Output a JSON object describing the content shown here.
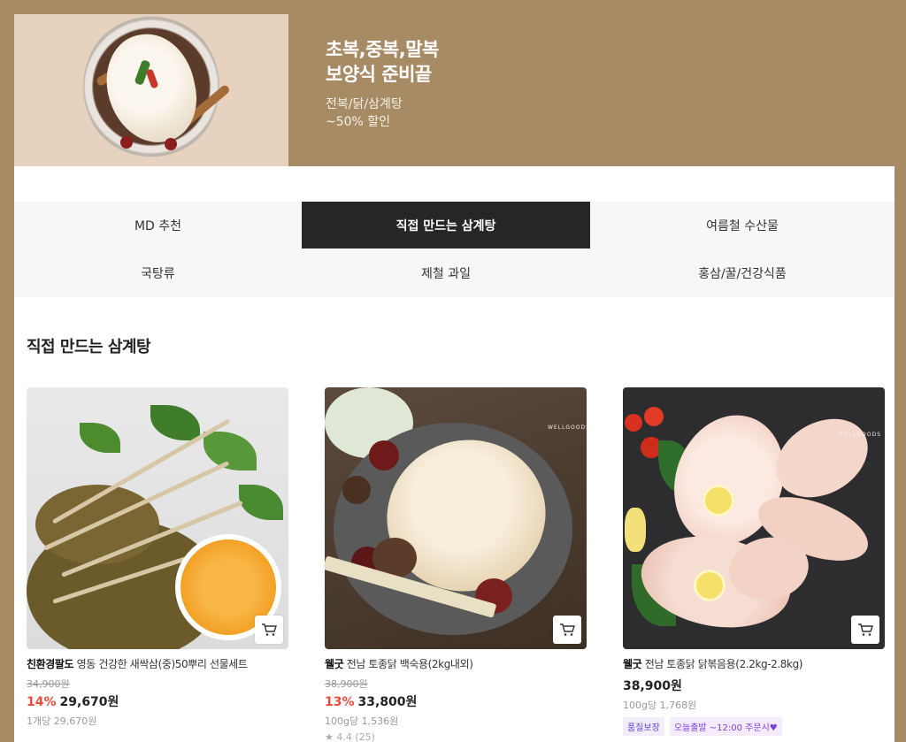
{
  "banner": {
    "title": "초복,중복,말복\n보양식 준비끝",
    "subtitle": "전복/닭/삼계탕\n~50% 할인"
  },
  "tabs": [
    {
      "label": "MD 추천",
      "active": false
    },
    {
      "label": "직접 만드는 삼계탕",
      "active": true
    },
    {
      "label": "여름철 수산물",
      "active": false
    },
    {
      "label": "국탕류",
      "active": false
    },
    {
      "label": "제철 과일",
      "active": false
    },
    {
      "label": "홍삼/꿀/건강식품",
      "active": false
    }
  ],
  "section": {
    "title": "직접 만드는 삼계탕"
  },
  "products": [
    {
      "brand": "친환경팔도",
      "name": "영동 건강한 새싹삼(중)50뿌리 선물세트",
      "original_price": "34,900원",
      "discount": "14%",
      "price": "29,670원",
      "unit_price": "1개당 29,670원",
      "cart_icon": "cart-icon"
    },
    {
      "brand": "웰굿",
      "name": "전남 토종닭 백숙용(2kg내외)",
      "original_price": "38,900원",
      "discount": "13%",
      "price": "33,800원",
      "unit_price": "100g당 1,536원",
      "rating": "★ 4.4 (25)",
      "cart_icon": "cart-icon"
    },
    {
      "brand": "웰굿",
      "name": "전남 토종닭 닭볶음용(2.2kg-2.8kg)",
      "price": "38,900원",
      "unit_price": "100g당 1,768원",
      "tags": [
        "품질보장",
        "오늘출발 ~12:00 주문시♥"
      ],
      "cart_icon": "cart-icon"
    }
  ],
  "colors": {
    "background": "#a68b65",
    "active_tab": "#262626",
    "discount": "#e74c3c"
  }
}
